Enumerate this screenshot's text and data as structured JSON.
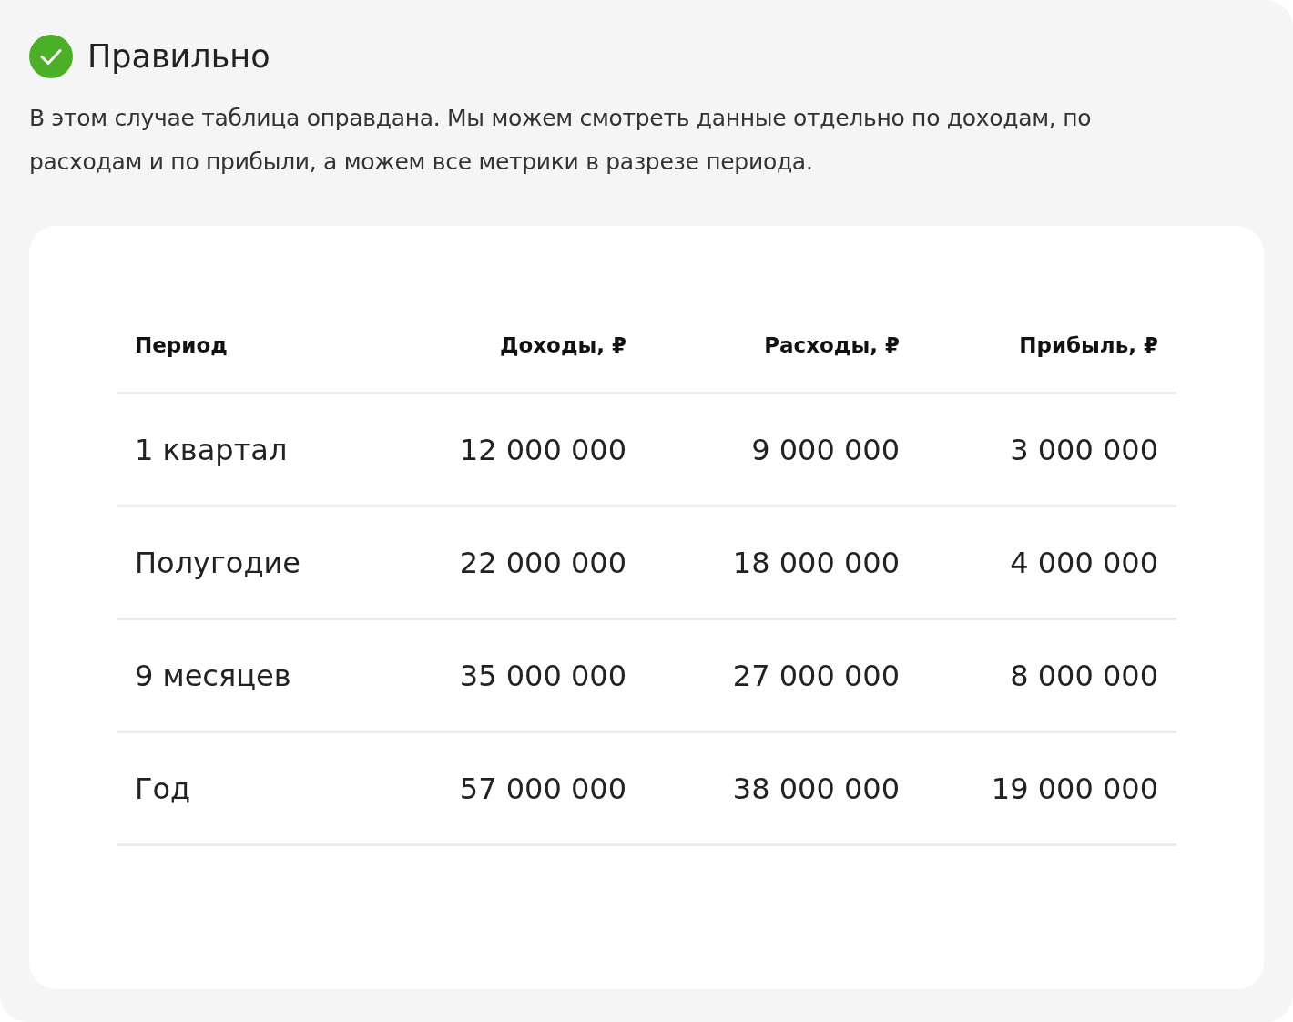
{
  "verdict": {
    "title": "Правильно",
    "correct": true
  },
  "description": "В этом случае таблица оправдана. Мы можем смотреть данные отдельно по доходам, по расходам и по прибыли, а можем все метрики в разрезе периода.",
  "table": {
    "columns": [
      "Период",
      "Доходы, ₽",
      "Расходы, ₽",
      "Прибыль, ₽"
    ],
    "rows": [
      [
        "1 квартал",
        "12 000 000",
        "9 000 000",
        "3 000 000"
      ],
      [
        "Полугодие",
        "22 000 000",
        "18 000 000",
        "4 000 000"
      ],
      [
        "9 месяцев",
        "35 000 000",
        "27 000 000",
        "8 000 000"
      ],
      [
        "Год",
        "57 000 000",
        "38 000 000",
        "19 000 000"
      ]
    ]
  }
}
